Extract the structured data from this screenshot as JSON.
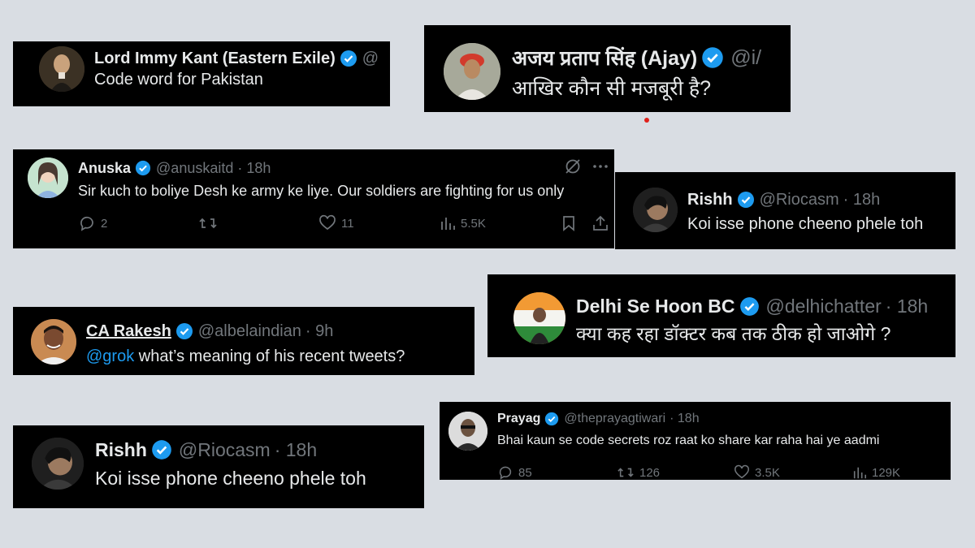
{
  "colors": {
    "background": "#d9dde3",
    "card": "#000000",
    "verified": "#1d9bf0",
    "muted": "#71767b",
    "text": "#e7e9ea"
  },
  "tweets": [
    {
      "name": "Lord Immy Kant (Eastern Exile)",
      "handle": "@",
      "time": "",
      "text": "Code word for Pakistan"
    },
    {
      "name": "अजय प्रताप सिंह (Ajay)",
      "handle": "@i/",
      "time": "",
      "text": "आखिर कौन सी मजबूरी है?"
    },
    {
      "name": "Anuska",
      "handle": "@anuskaitd",
      "time": "· 18h",
      "text": "Sir kuch to boliye Desh ke army ke liye. Our soldiers are fighting for us only",
      "replies": "2",
      "likes": "11",
      "views": "5.5K"
    },
    {
      "name": "Rishh",
      "handle": "@Riocasm",
      "time": "· 18h",
      "text": "Koi isse phone cheeno phele toh"
    },
    {
      "name": "Delhi Se Hoon BC",
      "handle": "@delhichatter",
      "time": "· 18h",
      "text": "क्या कह रहा डॉक्टर कब तक ठीक हो जाओगे ?"
    },
    {
      "name": "CA Rakesh",
      "handle": "@albelaindian",
      "time": "· 9h",
      "mention": "@grok",
      "text": " what’s meaning of his recent tweets?"
    },
    {
      "name": "Prayag",
      "handle": "@theprayagtiwari",
      "time": "· 18h",
      "text": "Bhai kaun se code secrets roz raat ko share kar raha hai ye aadmi",
      "replies": "85",
      "reposts": "126",
      "likes": "3.5K",
      "views": "129K"
    },
    {
      "name": "Rishh",
      "handle": "@Riocasm",
      "time": "· 18h",
      "text": "Koi isse phone cheeno phele toh"
    }
  ]
}
